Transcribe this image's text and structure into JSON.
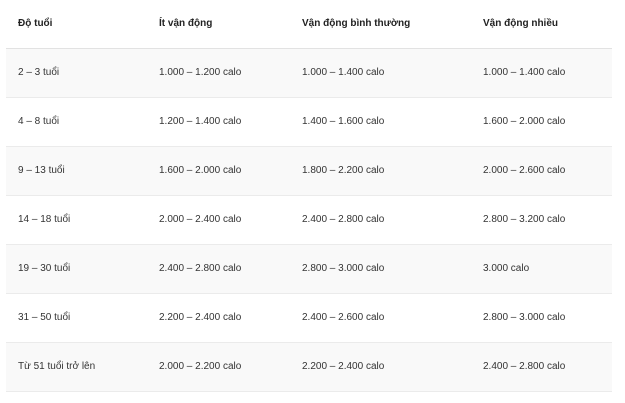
{
  "table": {
    "headers": [
      "Độ tuổi",
      "Ít vận động",
      "Vận động bình thường",
      "Vận động nhiều"
    ],
    "rows": [
      [
        "2 – 3 tuổi",
        "1.000 – 1.200 calo",
        "1.000 – 1.400 calo",
        "1.000 – 1.400 calo"
      ],
      [
        "4 – 8 tuổi",
        "1.200 – 1.400 calo",
        "1.400 – 1.600 calo",
        "1.600 – 2.000 calo"
      ],
      [
        "9 – 13 tuổi",
        "1.600 – 2.000 calo",
        "1.800 – 2.200 calo",
        "2.000 – 2.600 calo"
      ],
      [
        "14 – 18 tuổi",
        "2.000 – 2.400 calo",
        "2.400 – 2.800 calo",
        "2.800 – 3.200 calo"
      ],
      [
        "19 – 30 tuổi",
        "2.400 – 2.800 calo",
        "2.800 – 3.000 calo",
        "3.000 calo"
      ],
      [
        "31 – 50 tuổi",
        "2.200 – 2.400 calo",
        "2.400 – 2.600 calo",
        "2.800 – 3.000 calo"
      ],
      [
        "Từ 51 tuổi trở lên",
        "2.000 – 2.200 calo",
        "2.200 – 2.400 calo",
        "2.400 – 2.800 calo"
      ]
    ]
  }
}
